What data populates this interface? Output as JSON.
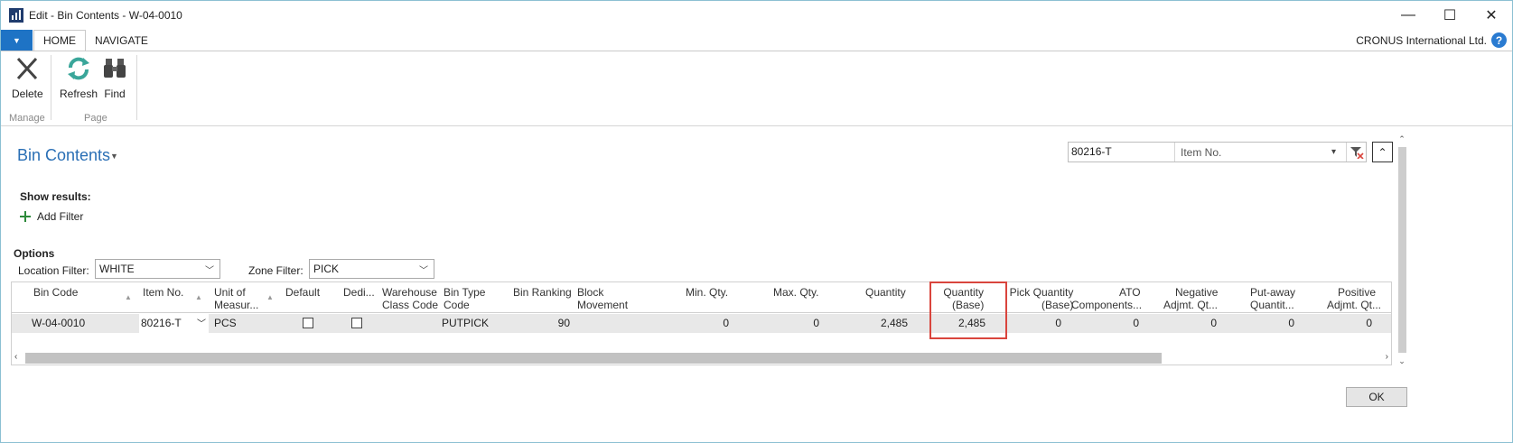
{
  "window": {
    "title": "Edit - Bin Contents - W-04-0010",
    "minimize": "—",
    "maximize": "☐",
    "close": "✕"
  },
  "ribbon_tabs": {
    "file_arrow": "▼",
    "home": "HOME",
    "navigate": "NAVIGATE",
    "company": "CRONUS International Ltd.",
    "help": "?"
  },
  "ribbon": {
    "delete_label": "Delete",
    "refresh_label": "Refresh",
    "find_label": "Find",
    "group_manage": "Manage",
    "group_page": "Page"
  },
  "page": {
    "title": "Bin Contents",
    "title_caret": "▼",
    "show_results": "Show results:",
    "add_filter": "Add Filter",
    "options": "Options"
  },
  "options": {
    "location_label": "Location Filter:",
    "location_value": "WHITE",
    "zone_label": "Zone Filter:",
    "zone_value": "PICK"
  },
  "search": {
    "value": "80216-T",
    "field": "Item No.",
    "chevron": "▾",
    "collapse": "⌃"
  },
  "grid": {
    "headers": {
      "bin_code": "Bin Code",
      "item_no": "Item No.",
      "uom_1": "Unit of",
      "uom_2": "Measur...",
      "default": "Default",
      "dedi": "Dedi...",
      "wh_class_1": "Warehouse",
      "wh_class_2": "Class Code",
      "bin_type_1": "Bin Type",
      "bin_type_2": "Code",
      "bin_ranking": "Bin Ranking",
      "block_1": "Block",
      "block_2": "Movement",
      "min_qty": "Min. Qty.",
      "max_qty": "Max. Qty.",
      "quantity": "Quantity",
      "qty_base_1": "Quantity",
      "qty_base_2": "(Base)",
      "pick_qty_1": "Pick Quantity",
      "pick_qty_2": "(Base)",
      "ato_1": "ATO",
      "ato_2": "Components...",
      "neg_1": "Negative",
      "neg_2": "Adjmt. Qt...",
      "putaway_1": "Put-away",
      "putaway_2": "Quantit...",
      "pos_1": "Positive",
      "pos_2": "Adjmt. Qt..."
    },
    "row": {
      "bin_code": "W-04-0010",
      "item_no": "80216-T",
      "uom": "PCS",
      "default": false,
      "dedicated": false,
      "wh_class": "",
      "bin_type": "PUTPICK",
      "bin_ranking": "90",
      "block": "",
      "min_qty": "0",
      "max_qty": "0",
      "quantity": "2,485",
      "qty_base": "2,485",
      "pick_qty": "0",
      "ato": "0",
      "neg": "0",
      "putaway": "0",
      "pos": "0"
    },
    "highlight_color": "#d9453d"
  },
  "footer": {
    "ok": "OK"
  }
}
